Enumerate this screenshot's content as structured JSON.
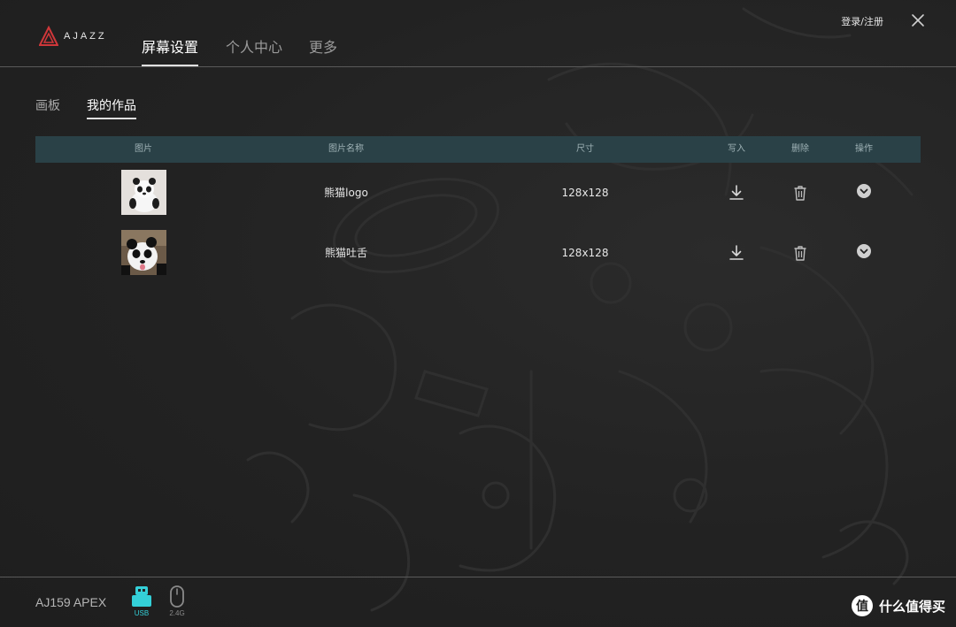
{
  "brand": {
    "logo_text": "AJAZZ"
  },
  "header": {
    "tabs": [
      {
        "label": "屏幕设置",
        "active": true
      },
      {
        "label": "个人中心",
        "active": false
      },
      {
        "label": "更多",
        "active": false
      }
    ],
    "login_label": "登录/注册"
  },
  "subtabs": [
    {
      "label": "画板",
      "active": false
    },
    {
      "label": "我的作品",
      "active": true
    }
  ],
  "table": {
    "columns": [
      "图片",
      "图片名称",
      "尺寸",
      "写入",
      "删除",
      "操作"
    ],
    "rows": [
      {
        "name": "熊猫logo",
        "size": "128x128"
      },
      {
        "name": "熊猫吐舌",
        "size": "128x128"
      }
    ]
  },
  "footer": {
    "device_name": "AJ159 APEX",
    "usb_label": "USB",
    "wireless_label": "2.4G",
    "watermark_text": "什么值得买",
    "watermark_badge": "值"
  },
  "colors": {
    "accent_usb": "#34d0d8",
    "table_header": "#2a4147"
  }
}
